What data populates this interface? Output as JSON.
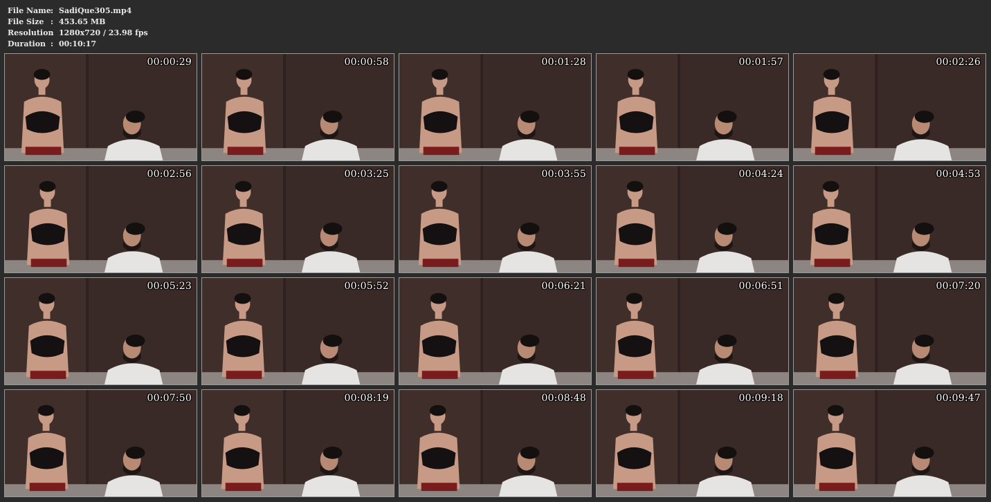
{
  "info": {
    "file_name_label": "File Name",
    "file_name": "SadiQue305.mp4",
    "file_size_label": "File Size",
    "file_size": "453.65 MB",
    "resolution_label": "Resolution",
    "resolution": "1280x720 / 23.98 fps",
    "duration_label": "Duration",
    "duration": "00:10:17",
    "separator": ":"
  },
  "thumbnails": [
    {
      "timestamp": "00:00:29"
    },
    {
      "timestamp": "00:00:58"
    },
    {
      "timestamp": "00:01:28"
    },
    {
      "timestamp": "00:01:57"
    },
    {
      "timestamp": "00:02:26"
    },
    {
      "timestamp": "00:02:56"
    },
    {
      "timestamp": "00:03:25"
    },
    {
      "timestamp": "00:03:55"
    },
    {
      "timestamp": "00:04:24"
    },
    {
      "timestamp": "00:04:53"
    },
    {
      "timestamp": "00:05:23"
    },
    {
      "timestamp": "00:05:52"
    },
    {
      "timestamp": "00:06:21"
    },
    {
      "timestamp": "00:06:51"
    },
    {
      "timestamp": "00:07:20"
    },
    {
      "timestamp": "00:07:50"
    },
    {
      "timestamp": "00:08:19"
    },
    {
      "timestamp": "00:08:48"
    },
    {
      "timestamp": "00:09:18"
    },
    {
      "timestamp": "00:09:47"
    }
  ],
  "colors": {
    "background": "#2b2b2b",
    "thumb_border": "#9a9a9a",
    "scene_backdrop": "#3a2a27",
    "skin": "#c79a85",
    "garment_dark": "#151112",
    "garment_red": "#7a1c1e",
    "shirt_white": "#e6e4e2"
  }
}
